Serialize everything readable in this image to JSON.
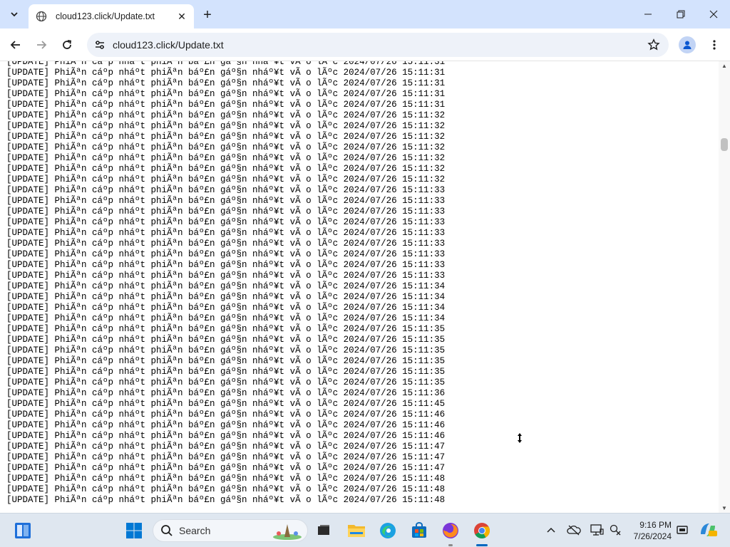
{
  "browser": {
    "tab_title": "cloud123.click/Update.txt",
    "url": "cloud123.click/Update.txt"
  },
  "log": {
    "prefix": "[UPDATE]",
    "message": "PhiÃªn cáº­p nháº­t phiÃªn báº£n gáº§n nháº¥t vÃ o lÃºc",
    "date": "2024/07/26",
    "times": [
      "15:11:31",
      "15:11:31",
      "15:11:31",
      "15:11:31",
      "15:11:31",
      "15:11:32",
      "15:11:32",
      "15:11:32",
      "15:11:32",
      "15:11:32",
      "15:11:32",
      "15:11:32",
      "15:11:33",
      "15:11:33",
      "15:11:33",
      "15:11:33",
      "15:11:33",
      "15:11:33",
      "15:11:33",
      "15:11:33",
      "15:11:33",
      "15:11:34",
      "15:11:34",
      "15:11:34",
      "15:11:34",
      "15:11:35",
      "15:11:35",
      "15:11:35",
      "15:11:35",
      "15:11:35",
      "15:11:35",
      "15:11:36",
      "15:11:45",
      "15:11:46",
      "15:11:46",
      "15:11:46",
      "15:11:47",
      "15:11:47",
      "15:11:47",
      "15:11:48",
      "15:11:48",
      "15:11:48"
    ]
  },
  "taskbar": {
    "search_label": "Search",
    "time": "9:16 PM",
    "date": "7/26/2024"
  },
  "colors": {
    "tabstrip": "#d3e3fd",
    "omnibox": "#eef2f9",
    "taskbar": "#dfe7f0",
    "accent": "#0067c0"
  }
}
